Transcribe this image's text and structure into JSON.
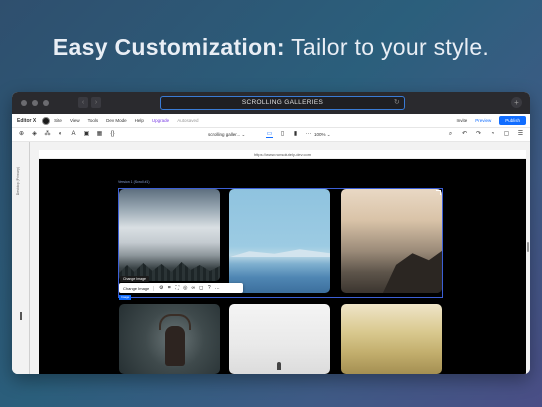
{
  "headline": {
    "strong": "Easy Customization:",
    "light": "Tailor to your style."
  },
  "browser": {
    "url_text": "SCROLLING GALLERIES",
    "reload_icon": "reload-icon",
    "new_tab_icon": "plus-icon"
  },
  "menubar": {
    "brand": "Editor X",
    "items": [
      "Site",
      "View",
      "Tools",
      "Dev Mode",
      "Help"
    ],
    "upgrade": "Upgrade",
    "autosave": "Autosaved",
    "invite": "Invite",
    "preview": "Preview",
    "publish": "Publish"
  },
  "toolbar": {
    "page_selector": "scrolling galler... ⌄",
    "zoom": "100% ⌄",
    "active_device": "desktop"
  },
  "canvas": {
    "page_url": "https://www.runsolutely-dev.com",
    "section_label": "Version 1 (Scroll #1)",
    "side_tab": "Desktop (Primary)",
    "tooltip": "Change Image",
    "action_label": "Change Image",
    "component_name": "Image"
  },
  "colors": {
    "accent": "#116dff",
    "upgrade": "#7b3fe4",
    "selection": "#3c5fd6"
  }
}
